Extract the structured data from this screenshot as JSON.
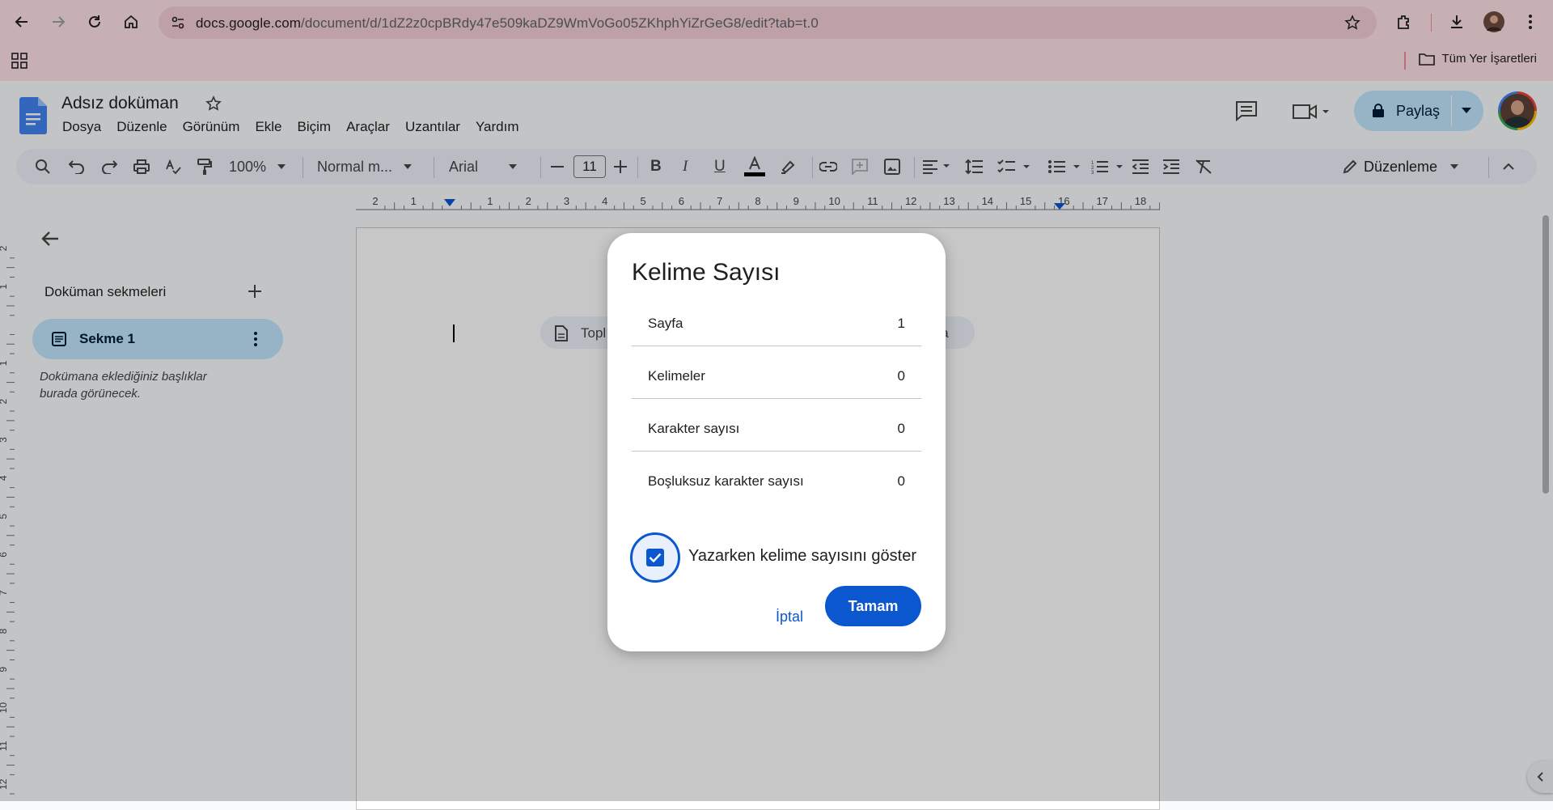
{
  "browser": {
    "url_host": "docs.google.com",
    "url_path": "/document/d/1dZ2z0cpBRdy47e509kaDZ9WmVoGo05ZKhphYiZrGeG8/edit?tab=t.0",
    "bookmarks_label": "Tüm Yer İşaretleri"
  },
  "docs": {
    "title": "Adsız doküman",
    "menu": [
      "Dosya",
      "Düzenle",
      "Görünüm",
      "Ekle",
      "Biçim",
      "Araçlar",
      "Uzantılar",
      "Yardım"
    ],
    "share_label": "Paylaş"
  },
  "toolbar": {
    "zoom": "100%",
    "style": "Normal m...",
    "font": "Arial",
    "font_size": "11",
    "mode": "Düzenleme"
  },
  "ruler": {
    "marks": [
      "2",
      "1",
      "",
      "1",
      "2",
      "3",
      "4",
      "5",
      "6",
      "7",
      "8",
      "9",
      "10",
      "11",
      "12",
      "13",
      "14",
      "15",
      "16",
      "17",
      "18"
    ],
    "vmarks": [
      "2",
      "1",
      "",
      "1",
      "2",
      "3",
      "4",
      "5",
      "6",
      "7",
      "8",
      "9",
      "10",
      "11",
      "12"
    ]
  },
  "sidebar": {
    "heading": "Doküman sekmeleri",
    "tab_label": "Sekme 1",
    "hint": "Dokümana eklediğiniz başlıklar burada görünecek."
  },
  "page": {
    "chip_left": "Topl",
    "chip_right": "zla"
  },
  "dialog": {
    "title": "Kelime Sayısı",
    "rows": [
      {
        "label": "Sayfa",
        "value": "1"
      },
      {
        "label": "Kelimeler",
        "value": "0"
      },
      {
        "label": "Karakter sayısı",
        "value": "0"
      },
      {
        "label": "Boşluksuz karakter sayısı",
        "value": "0"
      }
    ],
    "checkbox_label": "Yazarken kelime sayısını göster",
    "checkbox_checked": true,
    "cancel_label": "İptal",
    "ok_label": "Tamam"
  },
  "colors": {
    "accent": "#0b57d0",
    "chrome_bg": "#fee2e6",
    "share_bg": "#c2e7ff"
  }
}
